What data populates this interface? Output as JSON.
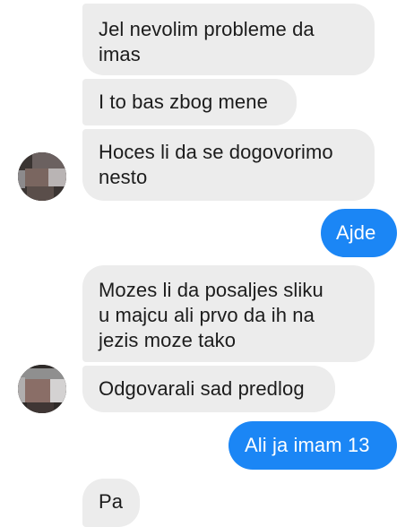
{
  "messages": [
    {
      "direction": "received",
      "text": "Jel nevolim probleme da\nimas"
    },
    {
      "direction": "received",
      "text": "I to bas zbog mene"
    },
    {
      "direction": "received",
      "text": "Hoces li da se dogovorimo\nnesto"
    },
    {
      "direction": "sent",
      "text": "Ajde"
    },
    {
      "direction": "received",
      "text": "Mozes li da posaljes sliku\nu majcu ali prvo da ih na\njezis moze tako"
    },
    {
      "direction": "received",
      "text": "Odgovarali sad predlog"
    },
    {
      "direction": "sent",
      "text": "Ali ja imam 13"
    },
    {
      "direction": "received",
      "text": "Pa"
    }
  ],
  "colors": {
    "sent_bubble": "#1b86f5",
    "received_bubble": "#ececec",
    "background": "#ffffff"
  },
  "icons": [
    "contact-avatar"
  ]
}
